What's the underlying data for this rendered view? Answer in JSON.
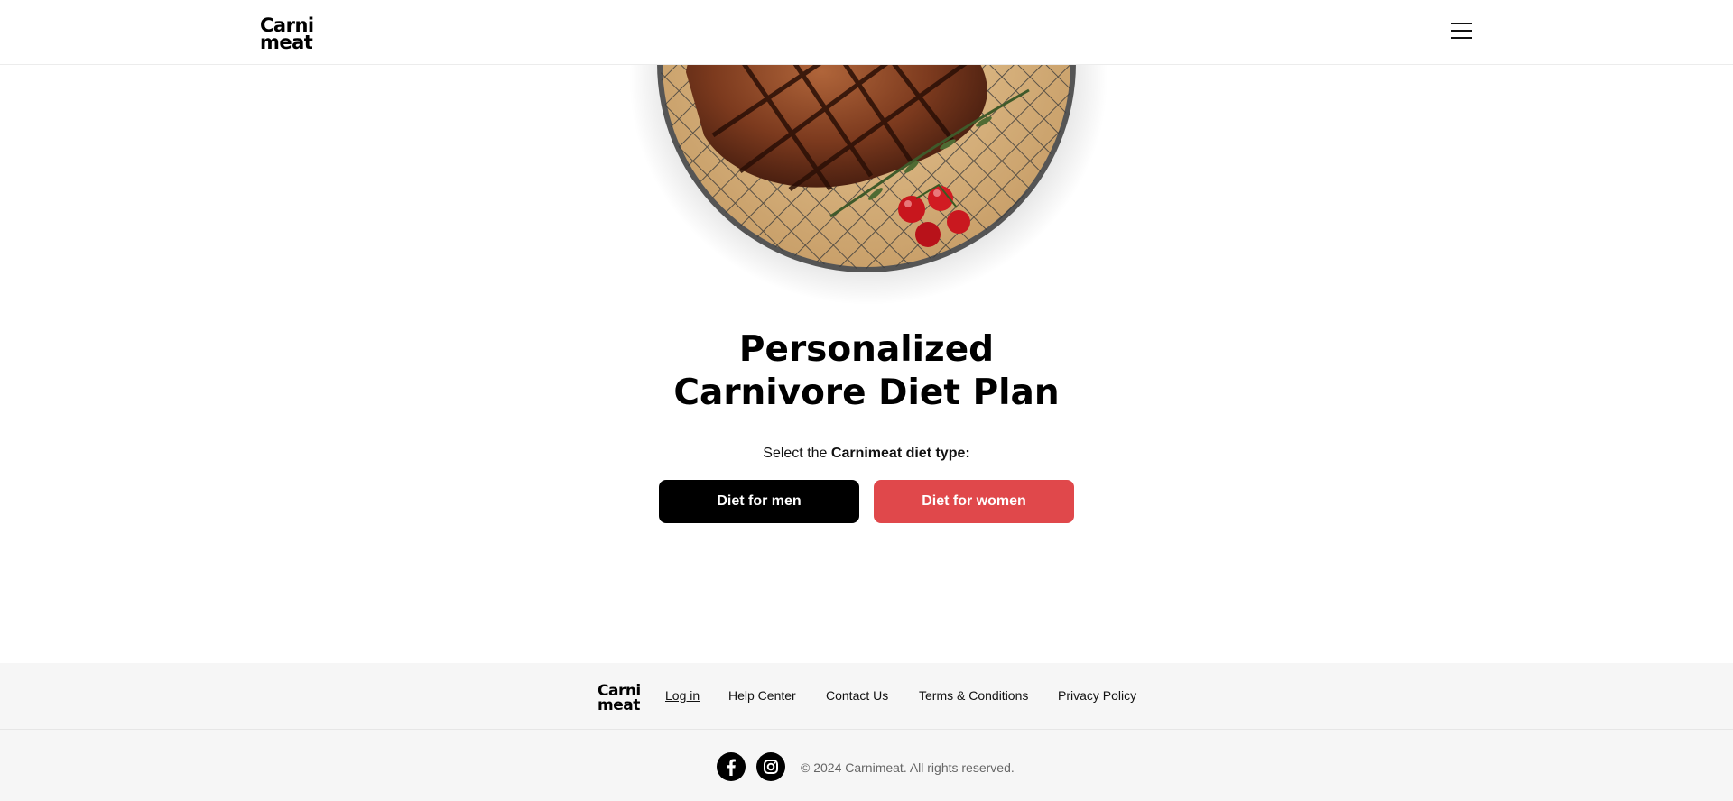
{
  "header": {
    "logo": {
      "line1": "Carni",
      "line2": "meat"
    },
    "menu_icon": "hamburger-menu-icon"
  },
  "hero": {
    "image": "grilled-steak-on-plate-with-rosemary-and-cherry-tomatoes"
  },
  "main": {
    "title_line1": "Personalized",
    "title_line2": "Carnivore Diet Plan",
    "subtitle_prefix": "Select the ",
    "subtitle_bold": "Carnimeat diet type:",
    "buttons": {
      "men": "Diet for men",
      "women": "Diet for women"
    }
  },
  "footer": {
    "logo": {
      "line1": "Carni",
      "line2": "meat"
    },
    "links": {
      "login": "Log in",
      "help": "Help Center",
      "contact": "Contact Us",
      "terms": "Terms & Conditions",
      "privacy": "Privacy Policy"
    },
    "social_icons": [
      "facebook-icon",
      "instagram-icon"
    ],
    "copyright": "© 2024 Carnimeat. All rights reserved."
  },
  "colors": {
    "primary_button": "#000000",
    "accent_button": "#e0484b",
    "footer_bg": "#f6f6f6",
    "copyright_text": "#666666"
  }
}
